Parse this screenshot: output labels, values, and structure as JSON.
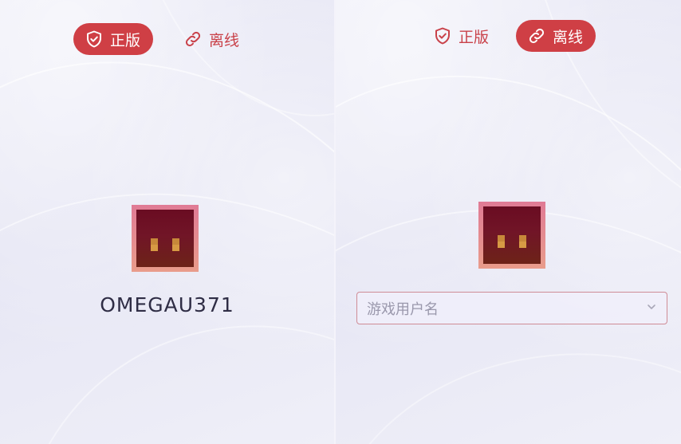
{
  "left_panel": {
    "tabs": [
      {
        "label": "正版",
        "icon": "shield-check-icon",
        "active": true
      },
      {
        "label": "离线",
        "icon": "link-icon",
        "active": false
      }
    ],
    "username": "OMEGAU371"
  },
  "right_panel": {
    "tabs": [
      {
        "label": "正版",
        "icon": "shield-check-icon",
        "active": false
      },
      {
        "label": "离线",
        "icon": "link-icon",
        "active": true
      }
    ],
    "username_field": {
      "placeholder": "游戏用户名",
      "value": ""
    }
  },
  "colors": {
    "accent": "#cf3f45",
    "accent_text": "#c94149",
    "avatar_frame": "#e07a95",
    "avatar_face": "#6a0c22"
  }
}
